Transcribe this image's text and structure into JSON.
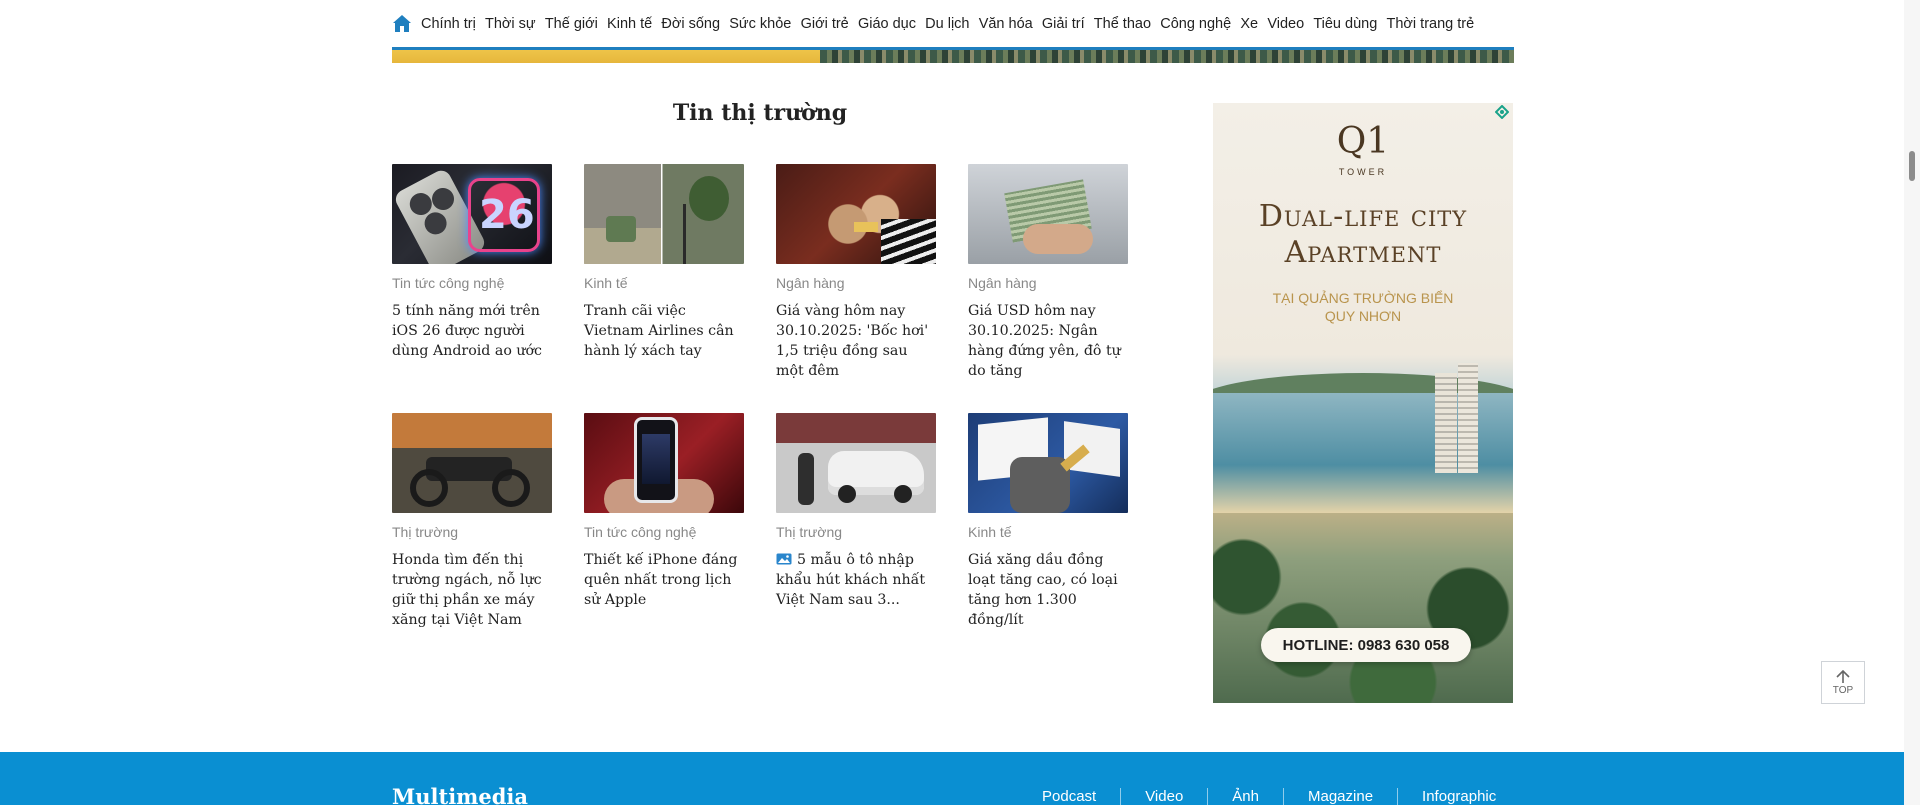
{
  "nav": {
    "items": [
      "Chính trị",
      "Thời sự",
      "Thế giới",
      "Kinh tế",
      "Đời sống",
      "Sức khỏe",
      "Giới trẻ",
      "Giáo dục",
      "Du lịch",
      "Văn hóa",
      "Giải trí",
      "Thể thao",
      "Công nghệ",
      "Xe",
      "Video",
      "Tiêu dùng",
      "Thời trang trẻ"
    ]
  },
  "section": {
    "title": "Tin thị trường"
  },
  "articles": [
    {
      "category": "Tin tức công nghệ",
      "headline": "5 tính năng mới trên iOS 26 được người dùng Android ao ước",
      "thumb": "phone-26"
    },
    {
      "category": "Kinh tế",
      "headline": "Tranh cãi việc Vietnam Airlines cân hành lý xách tay",
      "thumb": "airport-luggage"
    },
    {
      "category": "Ngân hàng",
      "headline": "Giá vàng hôm nay 30.10.2025: 'Bốc hơi' 1,5 triệu đồng sau một đêm",
      "thumb": "gold-hands"
    },
    {
      "category": "Ngân hàng",
      "headline": "Giá USD hôm nay 30.10.2025: Ngân hàng đứng yên, đô tự do tăng",
      "thumb": "dollar-counter"
    },
    {
      "category": "Thị trường",
      "headline": "Honda tìm đến thị trường ngách, nỗ lực giữ thị phần xe máy xăng tại Việt Nam",
      "thumb": "motorbike"
    },
    {
      "category": "Tin tức công nghệ",
      "headline": "Thiết kế iPhone đáng quên nhất trong lịch sử Apple",
      "thumb": "iphone-hand"
    },
    {
      "category": "Thị trường",
      "headline": "5 mẫu ô tô nhập khẩu hút khách nhất Việt Nam sau 3...",
      "thumb": "white-car",
      "has_photo_badge": true
    },
    {
      "category": "Kinh tế",
      "headline": "Giá xăng dầu đồng loạt tăng cao, có loại tăng hơn 1.300 đồng/lít",
      "thumb": "fuel-pump"
    }
  ],
  "ad": {
    "logo": "Q1",
    "logo_sub": "TOWER",
    "headline_line1": "Dual-life city",
    "headline_line2": "Apartment",
    "tag_line1": "TẠI QUẢNG TRƯỜNG BIỂN",
    "tag_line2": "QUY NHƠN",
    "hotline": "HOTLINE: 0983 630 058"
  },
  "back_to_top": {
    "label": "TOP"
  },
  "multimedia": {
    "title": "Multimedia",
    "links": [
      "Podcast",
      "Video",
      "Ảnh",
      "Magazine",
      "Infographic"
    ]
  },
  "colors": {
    "brand_blue": "#0a8fd2",
    "nav_home": "#1f7fbf"
  }
}
